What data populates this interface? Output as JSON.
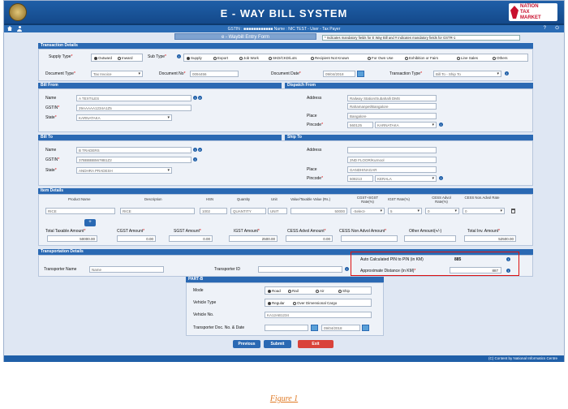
{
  "app": {
    "title": "E - WAY BILL SYSTEM",
    "logo_line1": "NATION",
    "logo_line2": "TAX",
    "logo_line3": "MARKET"
  },
  "navbar": {
    "gstin_text": "GSTIN : ■■■■■■■■■■■■ Name : NIC TEST - User - Tax Payer"
  },
  "page": {
    "title": "e - Waybill Entry Form",
    "mandatory_note": "* Indicates mandatory fields for E Way Bill and # indicates mandatory fields for GSTR-1"
  },
  "transaction_details": {
    "header": "Transaction Details",
    "supply_type_label": "Supply Type",
    "supply_options": [
      "Outward",
      "Inward"
    ],
    "sub_type_label": "Sub Type",
    "sub_type_options": [
      "Supply",
      "Export",
      "Job Work",
      "SKD/CKD/Lots",
      "Recipient Not Known",
      "For Own Use",
      "Exhibition or Fairs",
      "Line Sales",
      "Others"
    ],
    "document_type_label": "Document Type",
    "document_type_value": "Tax Invoice",
    "document_no_label": "Document No",
    "document_no_value": "0094456",
    "document_date_label": "Document Date",
    "document_date_value": "09/04/2018",
    "transaction_type_label": "Transaction Type",
    "transaction_type_value": "Bill To - Ship To"
  },
  "bill_from": {
    "header": "Bill From",
    "name_label": "Name",
    "name_value": "A TEXTILES",
    "gstin_label": "GSTIN",
    "gstin_value": "29AAAAA1234A1Z5",
    "state_label": "State",
    "state_value": "KARNATAKA"
  },
  "dispatch_from": {
    "header": "Dispatch From",
    "address_label": "Address",
    "address_line1": "Railway Station/Subahalli DMS",
    "address_line2": "Rahamanpet/Bangalore",
    "place_label": "Place",
    "place_value": "Bangalore",
    "pincode_label": "Pincode",
    "pincode_value": "560125",
    "pincode_state": "KARNATAKA"
  },
  "bill_to": {
    "header": "Bill To",
    "name_label": "Name",
    "name_value": "B TRADERS",
    "gstin_label": "GSTIN",
    "gstin_value": "37BBBBB5678B1Z2",
    "state_label": "State",
    "state_value": "ANDHRA PRADESH"
  },
  "ship_to": {
    "header": "Ship To",
    "address_label": "Address",
    "address_line1": "",
    "address_line2": "2ND FLOOR/Kurnool",
    "place_label": "Place",
    "place_value": "GANDHINAGAR",
    "pincode_label": "Pincode",
    "pincode_value": "508213",
    "pincode_state": "KERALA"
  },
  "item_details": {
    "header": "Item Details",
    "columns": [
      "Product Name",
      "Description",
      "HSN",
      "Quantity",
      "Unit",
      "Value/Taxable Value (Rs.)",
      "CGST+SGST Rate(%)",
      "IGST Rate(%)",
      "CESS Advol Rate(%)",
      "CESS Non.Advol Rate"
    ],
    "row": {
      "product": "RICE",
      "description": "RICE",
      "hsn": "1002",
      "quantity": "QUANTITY",
      "unit": "UNIT",
      "value": "50000",
      "cgst_sgst": "-Select-",
      "igst": "5",
      "cess_advol": "0",
      "cess_non_advol": "0"
    },
    "totals_labels": [
      "Total Taxable Amount",
      "CGST Amount",
      "SGST Amount",
      "IGST Amount",
      "CESS Advol Amount",
      "CESS Non Advol Amount",
      "Other Amount(+/-)",
      "Total Inv. Amount"
    ],
    "totals_values": [
      "50000.00",
      "0.00",
      "0.00",
      "2500.00",
      "0.00",
      "",
      "",
      "52500.00"
    ]
  },
  "transportation": {
    "header": "Transportation Details",
    "transporter_name_label": "Transporter Name",
    "transporter_name_placeholder": "Name",
    "transporter_id_label": "Transporter ID",
    "transporter_id_value": "",
    "auto_distance_label": "Auto Calculated PIN to PIN (in KM)",
    "auto_distance_value": "885",
    "approx_distance_label": "Approximate Distance (in KM)",
    "approx_distance_value": "887"
  },
  "part_b": {
    "header": "PART-B",
    "mode_label": "Mode",
    "mode_options": [
      "Road",
      "Rail",
      "Air",
      "Ship"
    ],
    "vehicle_type_label": "Vehicle Type",
    "vehicle_type_options": [
      "Regular",
      "Over Dimensional Cargo"
    ],
    "vehicle_no_label": "Vehicle No.",
    "vehicle_no_placeholder": "KA12AB1234",
    "transporter_doc_label": "Transporter Doc. No. & Date",
    "transporter_doc_date": "09/04/2018"
  },
  "buttons": {
    "previous": "Previous",
    "submit": "Submit",
    "exit": "Exit"
  },
  "footer": {
    "text": "(C) Content by National Informatics Centre"
  },
  "caption": "Figure 1",
  "colors": {
    "header_blue": "#2a69b3",
    "title_blue": "#1f5fa8",
    "highlight_red": "#d11111",
    "exit_red": "#d9433a",
    "caption_orange": "#e07a24"
  }
}
